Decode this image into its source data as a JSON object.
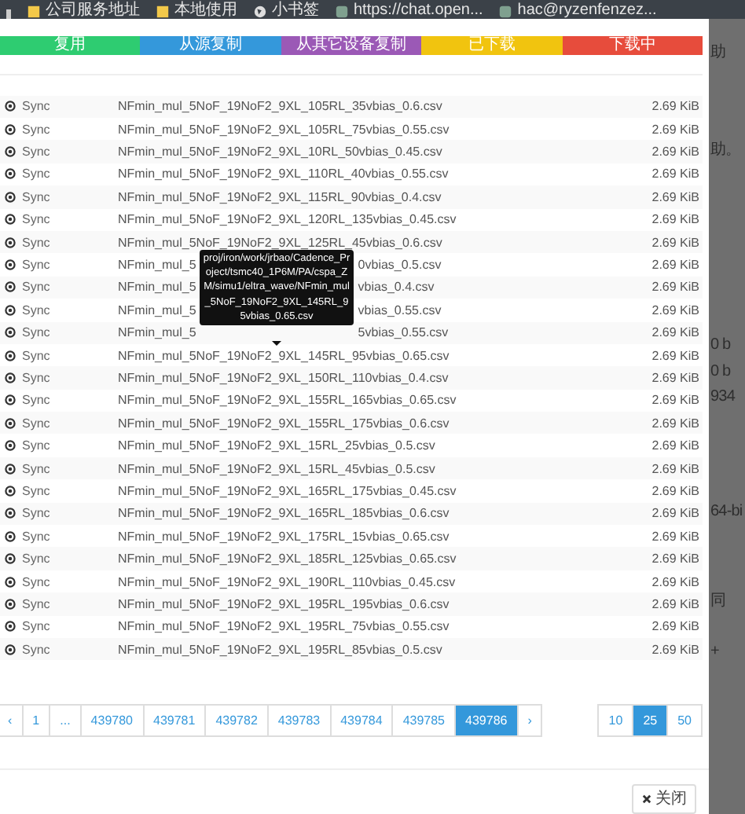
{
  "bookmarks_bar": {
    "items": [
      {
        "kind": "partial"
      },
      {
        "kind": "folder",
        "label": "公司服务地址"
      },
      {
        "kind": "folder",
        "label": "本地使用"
      },
      {
        "kind": "globe",
        "label": "小书签"
      },
      {
        "kind": "site",
        "label": "https://chat.open..."
      },
      {
        "kind": "site",
        "label": "hac@ryzenfenzez..."
      }
    ]
  },
  "legend": [
    {
      "label": "复用",
      "color": "#2ecc71"
    },
    {
      "label": "从源复制",
      "color": "#3498db"
    },
    {
      "label": "从其它设备复制",
      "color": "#9b59b6"
    },
    {
      "label": "已下载",
      "color": "#f1c40f"
    },
    {
      "label": "下载中",
      "color": "#e74c3c"
    }
  ],
  "files": [
    {
      "status": "Sync",
      "file": "NFmin_mul_5NoF_19NoF2_9XL_105RL_35vbias_0.6.csv",
      "size": "2.69 KiB"
    },
    {
      "status": "Sync",
      "file": "NFmin_mul_5NoF_19NoF2_9XL_105RL_75vbias_0.55.csv",
      "size": "2.69 KiB"
    },
    {
      "status": "Sync",
      "file": "NFmin_mul_5NoF_19NoF2_9XL_10RL_50vbias_0.45.csv",
      "size": "2.69 KiB"
    },
    {
      "status": "Sync",
      "file": "NFmin_mul_5NoF_19NoF2_9XL_110RL_40vbias_0.55.csv",
      "size": "2.69 KiB"
    },
    {
      "status": "Sync",
      "file": "NFmin_mul_5NoF_19NoF2_9XL_115RL_90vbias_0.4.csv",
      "size": "2.69 KiB"
    },
    {
      "status": "Sync",
      "file": "NFmin_mul_5NoF_19NoF2_9XL_120RL_135vbias_0.45.csv",
      "size": "2.69 KiB"
    },
    {
      "status": "Sync",
      "file": "NFmin_mul_5NoF_19NoF2_9XL_125RL_45vbias_0.6.csv",
      "size": "2.69 KiB"
    },
    {
      "status": "Sync",
      "file": "NFmin_mul_5",
      "file_end": "0vbias_0.5.csv",
      "size": "2.69 KiB"
    },
    {
      "status": "Sync",
      "file": "NFmin_mul_5",
      "file_end": "vbias_0.4.csv",
      "size": "2.69 KiB"
    },
    {
      "status": "Sync",
      "file": "NFmin_mul_5",
      "file_end": "vbias_0.55.csv",
      "size": "2.69 KiB"
    },
    {
      "status": "Sync",
      "file": "NFmin_mul_5",
      "file_end": "5vbias_0.55.csv",
      "size": "2.69 KiB"
    },
    {
      "status": "Sync",
      "file": "NFmin_mul_5NoF_19NoF2_9XL_145RL_95vbias_0.65.csv",
      "size": "2.69 KiB"
    },
    {
      "status": "Sync",
      "file": "NFmin_mul_5NoF_19NoF2_9XL_150RL_110vbias_0.4.csv",
      "size": "2.69 KiB"
    },
    {
      "status": "Sync",
      "file": "NFmin_mul_5NoF_19NoF2_9XL_155RL_165vbias_0.65.csv",
      "size": "2.69 KiB"
    },
    {
      "status": "Sync",
      "file": "NFmin_mul_5NoF_19NoF2_9XL_155RL_175vbias_0.6.csv",
      "size": "2.69 KiB"
    },
    {
      "status": "Sync",
      "file": "NFmin_mul_5NoF_19NoF2_9XL_15RL_25vbias_0.5.csv",
      "size": "2.69 KiB"
    },
    {
      "status": "Sync",
      "file": "NFmin_mul_5NoF_19NoF2_9XL_15RL_45vbias_0.5.csv",
      "size": "2.69 KiB"
    },
    {
      "status": "Sync",
      "file": "NFmin_mul_5NoF_19NoF2_9XL_165RL_175vbias_0.45.csv",
      "size": "2.69 KiB"
    },
    {
      "status": "Sync",
      "file": "NFmin_mul_5NoF_19NoF2_9XL_165RL_185vbias_0.6.csv",
      "size": "2.69 KiB"
    },
    {
      "status": "Sync",
      "file": "NFmin_mul_5NoF_19NoF2_9XL_175RL_15vbias_0.65.csv",
      "size": "2.69 KiB"
    },
    {
      "status": "Sync",
      "file": "NFmin_mul_5NoF_19NoF2_9XL_185RL_125vbias_0.65.csv",
      "size": "2.69 KiB"
    },
    {
      "status": "Sync",
      "file": "NFmin_mul_5NoF_19NoF2_9XL_190RL_110vbias_0.45.csv",
      "size": "2.69 KiB"
    },
    {
      "status": "Sync",
      "file": "NFmin_mul_5NoF_19NoF2_9XL_195RL_195vbias_0.6.csv",
      "size": "2.69 KiB"
    },
    {
      "status": "Sync",
      "file": "NFmin_mul_5NoF_19NoF2_9XL_195RL_75vbias_0.55.csv",
      "size": "2.69 KiB"
    },
    {
      "status": "Sync",
      "file": "NFmin_mul_5NoF_19NoF2_9XL_195RL_85vbias_0.5.csv",
      "size": "2.69 KiB"
    }
  ],
  "tooltip": {
    "text": "proj/iron/work/jrbao/Cadence_Project/tsmc40_1P6M/PA/cspa_ZM/simu1/eltra_wave/NFmin_mul_5NoF_19NoF2_9XL_145RL_95vbias_0.65.csv"
  },
  "pagination": {
    "prev": "‹",
    "next": "›",
    "pages": [
      {
        "label": "1",
        "selected": false
      },
      {
        "label": "...",
        "selected": false
      },
      {
        "label": "439780",
        "selected": false
      },
      {
        "label": "439781",
        "selected": false
      },
      {
        "label": "439782",
        "selected": false
      },
      {
        "label": "439783",
        "selected": false
      },
      {
        "label": "439784",
        "selected": false
      },
      {
        "label": "439785",
        "selected": false
      },
      {
        "label": "439786",
        "selected": true
      }
    ]
  },
  "page_sizes": [
    {
      "label": "10",
      "selected": false
    },
    {
      "label": "25",
      "selected": true
    },
    {
      "label": "50",
      "selected": false
    }
  ],
  "close_button": {
    "label": "关闭"
  },
  "background_fragments": [
    "助",
    "助。",
    "0 b",
    "0 b",
    "934",
    "64-bi",
    "同",
    "+"
  ]
}
